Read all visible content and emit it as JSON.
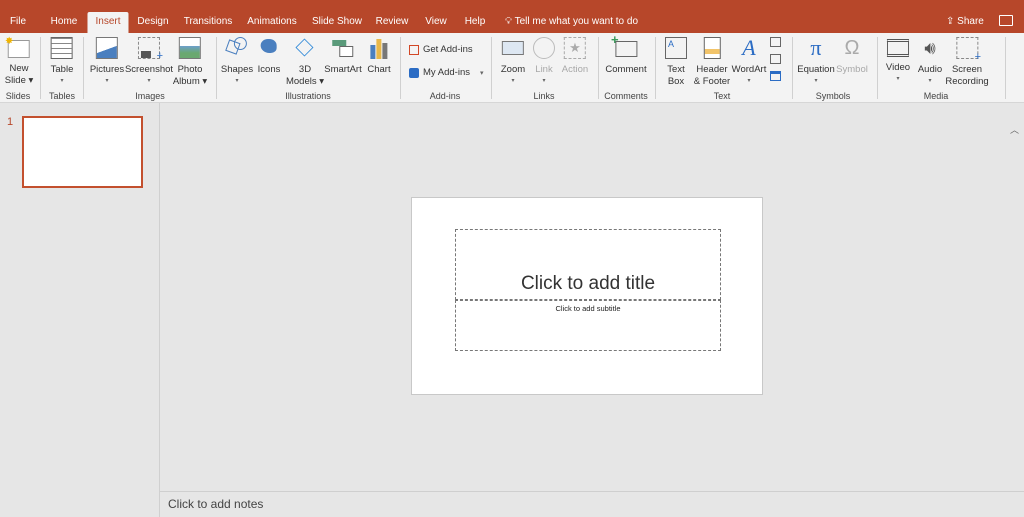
{
  "tabs": [
    "File",
    "Home",
    "Insert",
    "Design",
    "Transitions",
    "Animations",
    "Slide Show",
    "Review",
    "View",
    "Help"
  ],
  "active_tab": "Insert",
  "tell_me": "Tell me what you want to do",
  "share": "Share",
  "ribbon": {
    "buttons": {
      "new_slide": [
        "New",
        "Slide"
      ],
      "table": "Table",
      "pictures": "Pictures",
      "screenshot": "Screenshot",
      "photo_album": [
        "Photo",
        "Album"
      ],
      "shapes": "Shapes",
      "icons": "Icons",
      "models": [
        "3D",
        "Models"
      ],
      "smartart": "SmartArt",
      "chart": "Chart",
      "get_addins": "Get Add-ins",
      "my_addins": "My Add-ins",
      "zoom": "Zoom",
      "link": "Link",
      "action": "Action",
      "comment": "Comment",
      "text_box": [
        "Text",
        "Box"
      ],
      "header_footer": [
        "Header",
        "& Footer"
      ],
      "wordart": "WordArt",
      "equation": "Equation",
      "symbol": "Symbol",
      "video": "Video",
      "audio": "Audio",
      "screen_recording": [
        "Screen",
        "Recording"
      ]
    },
    "groups": [
      "Slides",
      "Tables",
      "Images",
      "Illustrations",
      "Add-ins",
      "Links",
      "Comments",
      "Text",
      "Symbols",
      "Media"
    ]
  },
  "colors": {
    "accent": "#b7472a",
    "ribbon_bg": "#f3f3f3"
  },
  "thumbnails": [
    {
      "number": "1"
    }
  ],
  "slide": {
    "title_placeholder": "Click to add title",
    "subtitle_placeholder": "Click to add subtitle"
  },
  "notes_placeholder": "Click to add notes"
}
